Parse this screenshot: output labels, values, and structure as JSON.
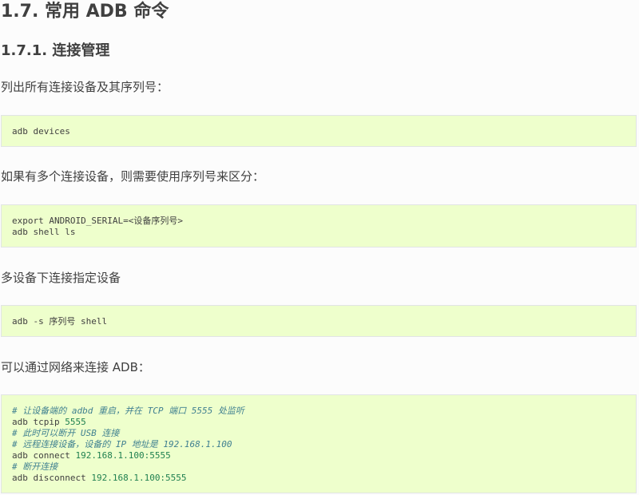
{
  "heading1": "1.7. 常用 ADB 命令",
  "heading2": "1.7.1. 连接管理",
  "para1": "列出所有连接设备及其序列号：",
  "code1": [
    "adb devices"
  ],
  "para2": "如果有多个连接设备，则需要使用序列号来区分：",
  "code2": [
    "export ANDROID_SERIAL=<设备序列号>",
    "adb shell ls"
  ],
  "para3": "多设备下连接指定设备",
  "code3": [
    "adb -s 序列号 shell"
  ],
  "para4": "可以通过网络来连接 ADB：",
  "code4": {
    "comment1": "# 让设备端的 adbd 重启，并在 TCP 端口 5555 处监听",
    "cmd1": "adb tcpip ",
    "arg1": "5555",
    "comment2": "# 此时可以断开 USB 连接",
    "comment3": "# 远程连接设备，设备的 IP 地址是 192.168.1.100",
    "cmd2": "adb connect ",
    "arg2": "192.168.1.100:5555",
    "comment4": "# 断开连接",
    "cmd3": "adb disconnect ",
    "arg3": "192.168.1.100:5555"
  },
  "colors": {
    "code_bg": "#eeffcc",
    "comment": "#408090",
    "number": "#208050",
    "text": "#404040"
  }
}
